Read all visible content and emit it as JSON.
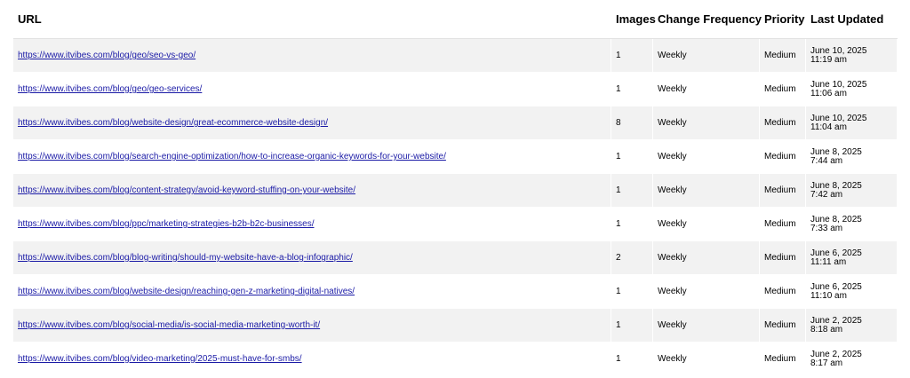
{
  "headers": {
    "url": "URL",
    "images": "Images",
    "change_frequency": "Change Frequency",
    "priority": "Priority",
    "last_updated": "Last Updated"
  },
  "rows": [
    {
      "url": "https://www.itvibes.com/blog/geo/seo-vs-geo/",
      "images": "1",
      "frequency": "Weekly",
      "priority": "Medium",
      "date": "June 10, 2025",
      "time": "11:19 am"
    },
    {
      "url": "https://www.itvibes.com/blog/geo/geo-services/",
      "images": "1",
      "frequency": "Weekly",
      "priority": "Medium",
      "date": "June 10, 2025",
      "time": "11:06 am"
    },
    {
      "url": "https://www.itvibes.com/blog/website-design/great-ecommerce-website-design/",
      "images": "8",
      "frequency": "Weekly",
      "priority": "Medium",
      "date": "June 10, 2025",
      "time": "11:04 am"
    },
    {
      "url": "https://www.itvibes.com/blog/search-engine-optimization/how-to-increase-organic-keywords-for-your-website/",
      "images": "1",
      "frequency": "Weekly",
      "priority": "Medium",
      "date": "June 8, 2025",
      "time": "7:44 am"
    },
    {
      "url": "https://www.itvibes.com/blog/content-strategy/avoid-keyword-stuffing-on-your-website/",
      "images": "1",
      "frequency": "Weekly",
      "priority": "Medium",
      "date": "June 8, 2025",
      "time": "7:42 am"
    },
    {
      "url": "https://www.itvibes.com/blog/ppc/marketing-strategies-b2b-b2c-businesses/",
      "images": "1",
      "frequency": "Weekly",
      "priority": "Medium",
      "date": "June 8, 2025",
      "time": "7:33 am"
    },
    {
      "url": "https://www.itvibes.com/blog/blog-writing/should-my-website-have-a-blog-infographic/",
      "images": "2",
      "frequency": "Weekly",
      "priority": "Medium",
      "date": "June 6, 2025",
      "time": "11:11 am"
    },
    {
      "url": "https://www.itvibes.com/blog/website-design/reaching-gen-z-marketing-digital-natives/",
      "images": "1",
      "frequency": "Weekly",
      "priority": "Medium",
      "date": "June 6, 2025",
      "time": "11:10 am"
    },
    {
      "url": "https://www.itvibes.com/blog/social-media/is-social-media-marketing-worth-it/",
      "images": "1",
      "frequency": "Weekly",
      "priority": "Medium",
      "date": "June 2, 2025",
      "time": "8:18 am"
    },
    {
      "url": "https://www.itvibes.com/blog/video-marketing/2025-must-have-for-smbs/",
      "images": "1",
      "frequency": "Weekly",
      "priority": "Medium",
      "date": "June 2, 2025",
      "time": "8:17 am"
    }
  ],
  "colors": {
    "link": "#1a1aa6",
    "row_shaded": "#f2f2f2",
    "row_plain": "#ffffff"
  }
}
